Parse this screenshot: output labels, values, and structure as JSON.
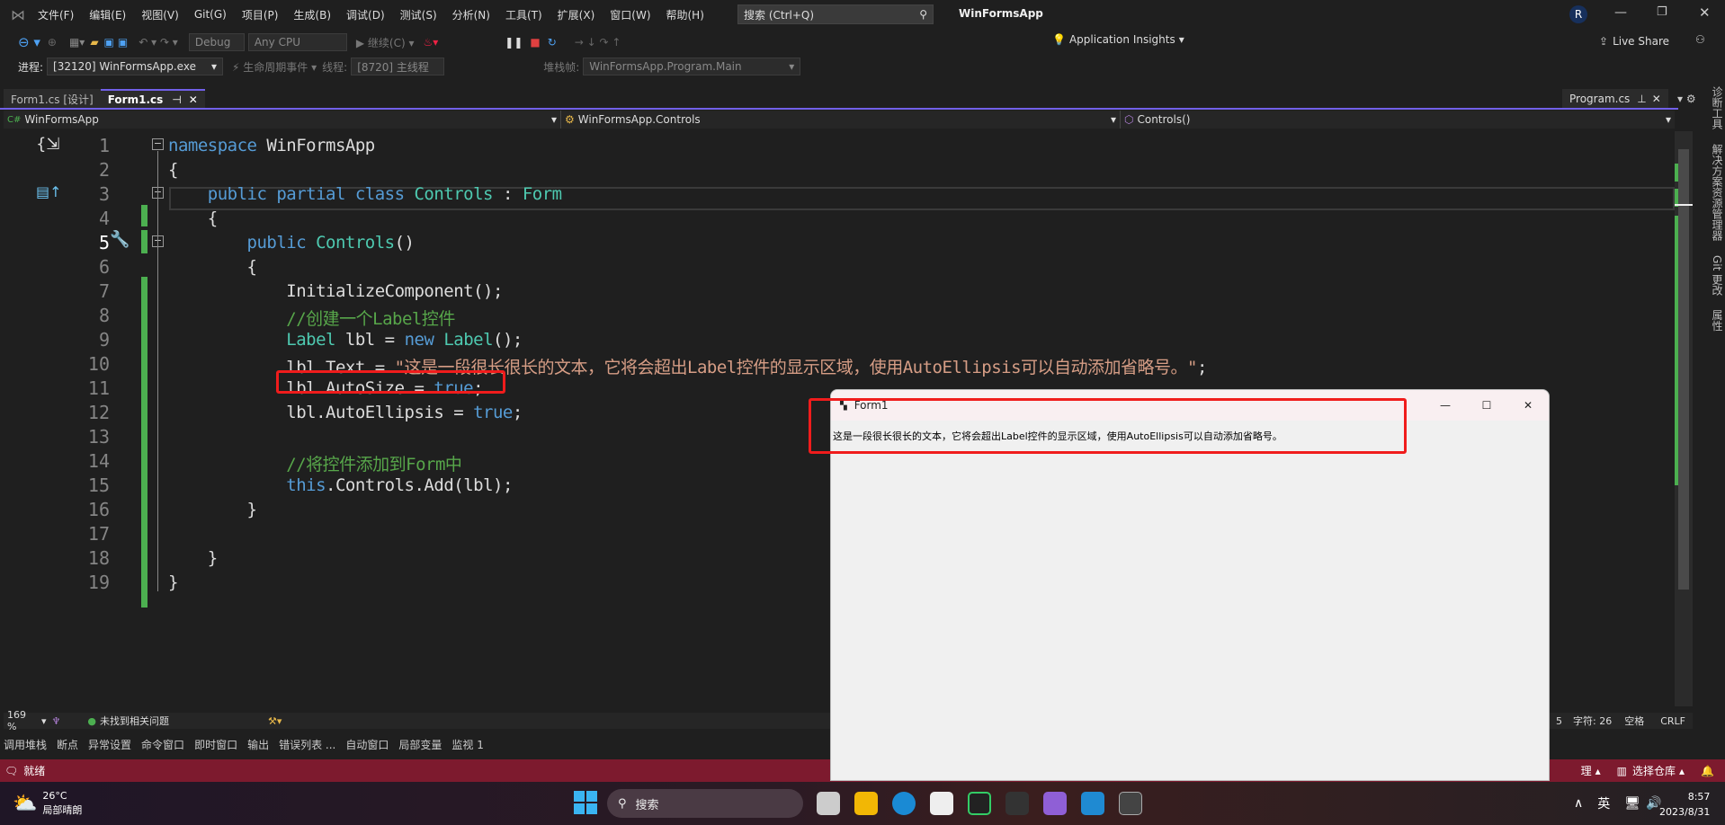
{
  "app": {
    "title": "WinFormsApp",
    "user_initial": "R"
  },
  "menu": [
    "文件(F)",
    "编辑(E)",
    "视图(V)",
    "Git(G)",
    "项目(P)",
    "生成(B)",
    "调试(D)",
    "测试(S)",
    "分析(N)",
    "工具(T)",
    "扩展(X)",
    "窗口(W)",
    "帮助(H)"
  ],
  "search": {
    "placeholder": "搜索 (Ctrl+Q)"
  },
  "toolbar": {
    "config": "Debug",
    "platform": "Any CPU",
    "continue": "继续(C)",
    "app_insights": "Application Insights",
    "live_share": "Live Share"
  },
  "debugbar": {
    "process_label": "进程:",
    "process": "[32120] WinFormsApp.exe",
    "lifecycle": "生命周期事件",
    "thread_label": "线程:",
    "thread": "[8720] 主线程",
    "stack_label": "堆栈帧:",
    "stack": "WinFormsApp.Program.Main"
  },
  "tabs": [
    {
      "label": "Form1.cs [设计]",
      "active": false
    },
    {
      "label": "Form1.cs",
      "active": true
    }
  ],
  "right_tab": "Program.cs",
  "navbar": {
    "project": "WinFormsApp",
    "type": "WinFormsApp.Controls",
    "member": "Controls()"
  },
  "side_tools": [
    "诊断工具",
    "解决方案资源管理器",
    "Git 更改",
    "属性"
  ],
  "code": {
    "line_numbers": [
      "1",
      "2",
      "3",
      "4",
      "5",
      "6",
      "7",
      "8",
      "9",
      "10",
      "11",
      "12",
      "13",
      "14",
      "15",
      "16",
      "17",
      "18",
      "19"
    ],
    "lines": [
      [
        [
          "namespace ",
          "k"
        ],
        [
          "WinFormsApp",
          "p"
        ]
      ],
      [
        [
          "{",
          "p"
        ]
      ],
      [
        [
          "    public partial class ",
          "k"
        ],
        [
          "Controls",
          "t"
        ],
        [
          " : ",
          "p"
        ],
        [
          "Form",
          "t"
        ]
      ],
      [
        [
          "    {",
          "p"
        ]
      ],
      [
        [
          "        public ",
          "k"
        ],
        [
          "Controls",
          "t"
        ],
        [
          "()",
          "p"
        ]
      ],
      [
        [
          "        {",
          "p"
        ]
      ],
      [
        [
          "            InitializeComponent();",
          "p"
        ]
      ],
      [
        [
          "            //创建一个Label控件",
          "c"
        ]
      ],
      [
        [
          "            ",
          "p"
        ],
        [
          "Label",
          "t"
        ],
        [
          " lbl = ",
          "p"
        ],
        [
          "new ",
          "k"
        ],
        [
          "Label",
          "t"
        ],
        [
          "();",
          "p"
        ]
      ],
      [
        [
          "            lbl.Text = ",
          "p"
        ],
        [
          "\"这是一段很长很长的文本，它将会超出Label控件的显示区域，使用AutoEllipsis可以自动添加省略号。\"",
          "s"
        ],
        [
          ";",
          "p"
        ]
      ],
      [
        [
          "            lbl.AutoSize = ",
          "p"
        ],
        [
          "true",
          "k"
        ],
        [
          ";",
          "p"
        ]
      ],
      [
        [
          "            lbl.AutoEllipsis = ",
          "p"
        ],
        [
          "true",
          "k"
        ],
        [
          ";",
          "p"
        ]
      ],
      [
        [
          "",
          "p"
        ]
      ],
      [
        [
          "            //将控件添加到Form中",
          "c"
        ]
      ],
      [
        [
          "            ",
          "p"
        ],
        [
          "this",
          "k"
        ],
        [
          ".Controls.Add(lbl);",
          "p"
        ]
      ],
      [
        [
          "        }",
          "p"
        ]
      ],
      [
        [
          "",
          "p"
        ]
      ],
      [
        [
          "    }",
          "p"
        ]
      ],
      [
        [
          "}",
          "p"
        ]
      ]
    ]
  },
  "form1": {
    "title": "Form1",
    "label_text": "这是一段很长很长的文本，它将会超出Label控件的显示区域，使用AutoEllipsis可以自动添加省略号。"
  },
  "editor_status": {
    "zoom": "169 %",
    "issues": "未找到相关问题",
    "col": "5",
    "char": "字符: 26",
    "spaces": "空格",
    "eol": "CRLF"
  },
  "bottom_tabs": [
    "调用堆栈",
    "断点",
    "异常设置",
    "命令窗口",
    "即时窗口",
    "输出",
    "错误列表 ...",
    "自动窗口",
    "局部变量",
    "监视 1"
  ],
  "statusbar": {
    "ready": "就绪",
    "manage": "理",
    "repo": "选择仓库"
  },
  "taskbar": {
    "temp": "26°C",
    "weather": "局部晴朗",
    "search": "搜索",
    "ime": "英",
    "time": "8:57",
    "date": "2023/8/31"
  },
  "colors": {
    "accent": "#7160e8",
    "status": "#7d1a2e",
    "highlight_box": "#f01c1c",
    "change_bar": "#4caf50"
  }
}
